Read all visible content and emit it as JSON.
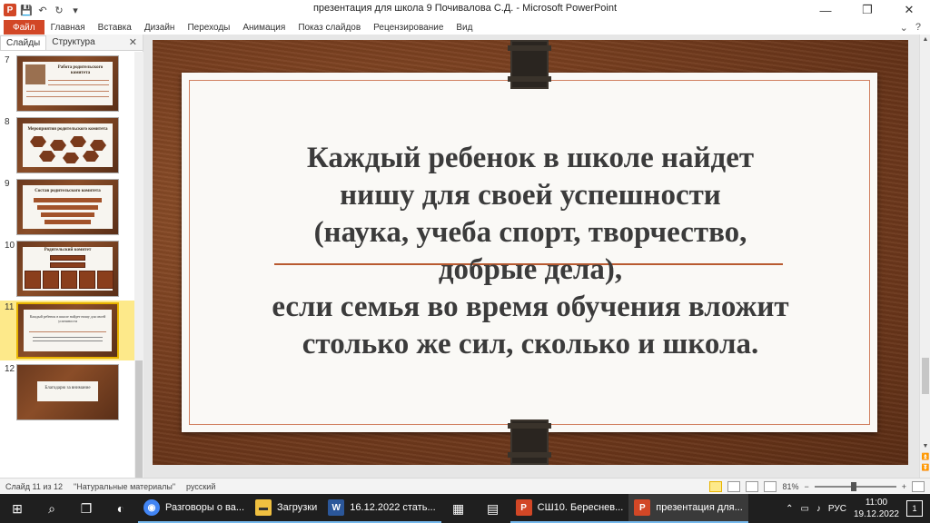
{
  "window": {
    "title": "презентация для школа 9 Почивалова С.Д.  -  Microsoft PowerPoint",
    "qat_icons": [
      "powerpoint-logo",
      "save-icon",
      "undo-icon",
      "redo-icon",
      "customize-icon"
    ],
    "controls": [
      "minimize",
      "restore",
      "close"
    ]
  },
  "ribbon": {
    "file_tab": "Файл",
    "tabs": [
      "Главная",
      "Вставка",
      "Дизайн",
      "Переходы",
      "Анимация",
      "Показ слайдов",
      "Рецензирование",
      "Вид"
    ]
  },
  "left_panel": {
    "tabs": [
      "Слайды",
      "Структура"
    ],
    "close_glyph": "✕",
    "thumbnails": [
      {
        "number": "7",
        "title": "Работа родительского комитета"
      },
      {
        "number": "8",
        "title": "Мероприятия родительского комитета"
      },
      {
        "number": "9",
        "title": "Состав родительского комитета"
      },
      {
        "number": "10",
        "title": "Родительский комитет"
      },
      {
        "number": "11",
        "title": "Каждый ребенок в школе найдет нишу для своей успешности",
        "selected": true
      },
      {
        "number": "12",
        "title": "Благодарю за внимание"
      }
    ]
  },
  "slide": {
    "lines": [
      "Каждый ребенок в школе найдет",
      "нишу для своей успешности",
      "(наука, учеба спорт, творчество,",
      "добрые дела),",
      "если семья во время обучения вложит",
      "столько же сил, сколько и школа."
    ],
    "colors": {
      "wood": "#7a4020",
      "card": "#faf9f6",
      "accent_line": "#b85a30",
      "text": "#3b3b3b"
    }
  },
  "statusbar": {
    "slide_counter": "Слайд 11 из 12",
    "theme": "\"Натуральные материалы\"",
    "language": "русский",
    "zoom": "81%",
    "zoom_minus": "−",
    "zoom_plus": "+"
  },
  "taskbar": {
    "apps": [
      {
        "name": "Разговоры о ва...",
        "icon": "chrome-icon",
        "color": "#e8b400"
      },
      {
        "name": "Загрузки",
        "icon": "folder-icon",
        "color": "#f0c040"
      },
      {
        "name": "16.12.2022 стать...",
        "icon": "word-icon",
        "color": "#2b579a",
        "glyph": "W"
      },
      {
        "name": "СШ10. Береснев...",
        "icon": "powerpoint-icon",
        "color": "#d24726",
        "glyph": "P"
      },
      {
        "name": "презентация для...",
        "icon": "powerpoint-icon",
        "color": "#d24726",
        "glyph": "P",
        "active": true
      }
    ],
    "language": "РУС",
    "time": "11:00",
    "date": "19.12.2022",
    "notifications": "1"
  }
}
